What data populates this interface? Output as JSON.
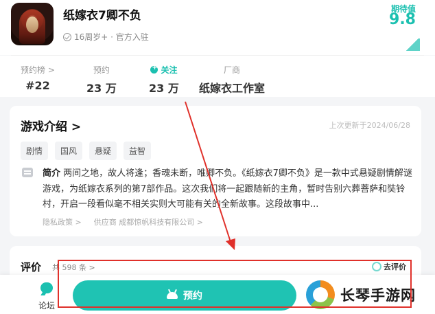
{
  "header": {
    "app_title": "纸嫁衣7卿不负",
    "meta": "16周岁+ · 官方入驻",
    "rating_label": "期待值",
    "rating_value": "9.8"
  },
  "stats": [
    {
      "label": "预约榜 >",
      "value": "#22"
    },
    {
      "label": "预约",
      "value": "23 万"
    },
    {
      "label": "关注",
      "value": "23 万"
    },
    {
      "label": "厂商",
      "value": "纸嫁衣工作室"
    }
  ],
  "intro": {
    "title": "游戏介绍 >",
    "updated": "上次更新于2024/06/28",
    "tags": [
      "剧情",
      "国风",
      "悬疑",
      "益智"
    ],
    "summary_label": "简介",
    "summary": "两间之地，故人将逢；香魂未断，唯卿不负。《纸嫁衣7卿不负》是一款中式悬疑剧情解谜游戏，为纸嫁衣系列的第7部作品。这次我们将一起跟随新的主角，暂时告别六葬菩萨和奘铃村，开启一段看似毫不相关实则大可能有关的全新故事。这段故事中...",
    "privacy": "隐私政策 >",
    "supplier": "供应商 成都惊帆科技有限公司 >"
  },
  "review": {
    "title": "评价",
    "count": "共 598 条 >",
    "action": "去评价"
  },
  "bottom": {
    "forum": "论坛",
    "book": "预约"
  },
  "watermark": "长琴手游网",
  "colors": {
    "accent": "#1fc3b3",
    "annotation": "#e0302a"
  }
}
